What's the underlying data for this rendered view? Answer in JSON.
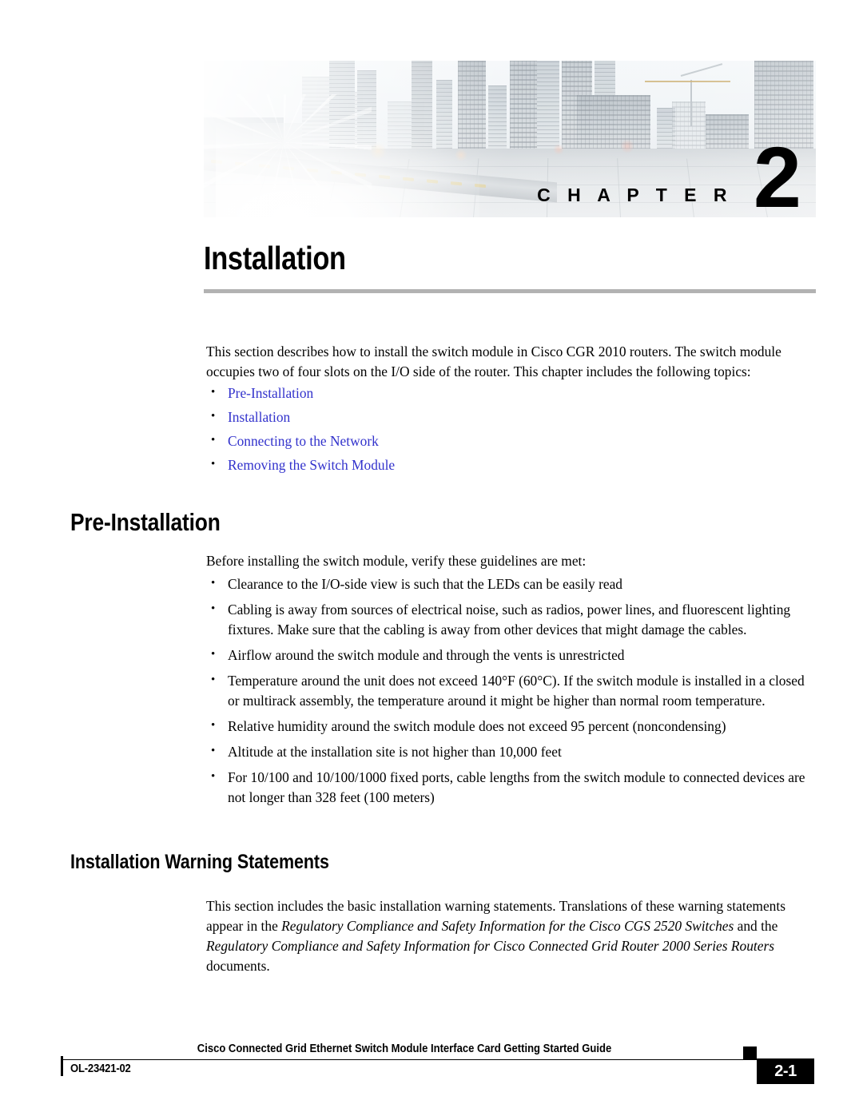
{
  "banner": {
    "chapter_word": "C H A P T E R",
    "chapter_number": "2",
    "image_description": "city-skyline-photo"
  },
  "chapter": {
    "title": "Installation"
  },
  "intro": {
    "paragraph": "This section describes how to install the switch module in Cisco CGR 2010 routers. The switch module occupies two of four slots on the I/O side of the router. This chapter includes the following topics:",
    "links": [
      "Pre-Installation",
      "Installation",
      "Connecting to the Network",
      "Removing the Switch Module"
    ]
  },
  "pre_installation": {
    "heading": "Pre-Installation",
    "lead": "Before installing the switch module, verify these guidelines are met:",
    "bullets": [
      "Clearance to the I/O-side view is such that the LEDs can be easily read",
      "Cabling is away from sources of electrical noise, such as radios, power lines, and fluorescent lighting fixtures. Make sure that the cabling is away from other devices that might damage the cables.",
      "Airflow around the switch module and through the vents is unrestricted",
      "Temperature around the unit does not exceed 140°F (60°C). If the switch module is installed in a closed or multirack assembly, the temperature around it might be higher than normal room temperature.",
      "Relative humidity around the switch module does not exceed 95 percent (noncondensing)",
      "Altitude at the installation site is not higher than 10,000 feet",
      "For 10/100 and 10/100/1000 fixed ports, cable lengths from the switch module to connected devices are not longer than 328 feet (100 meters)"
    ]
  },
  "warning_statements": {
    "heading": "Installation Warning Statements",
    "text_part1": "This section includes the basic installation warning statements. Translations of these warning statements appear in the ",
    "italic1": "Regulatory Compliance and Safety Information for the Cisco CGS 2520 Switches",
    "text_part2": " and the ",
    "italic2": "Regulatory Compliance and Safety Information for Cisco Connected Grid Router 2000 Series Routers",
    "text_part3": " documents."
  },
  "footer": {
    "doc_title": "Cisco Connected Grid Ethernet Switch Module Interface Card Getting Started Guide",
    "doc_id": "OL-23421-02",
    "page_number": "2-1"
  },
  "colors": {
    "link": "#3232CC",
    "rule": "#B2B2B2",
    "text": "#000000"
  }
}
